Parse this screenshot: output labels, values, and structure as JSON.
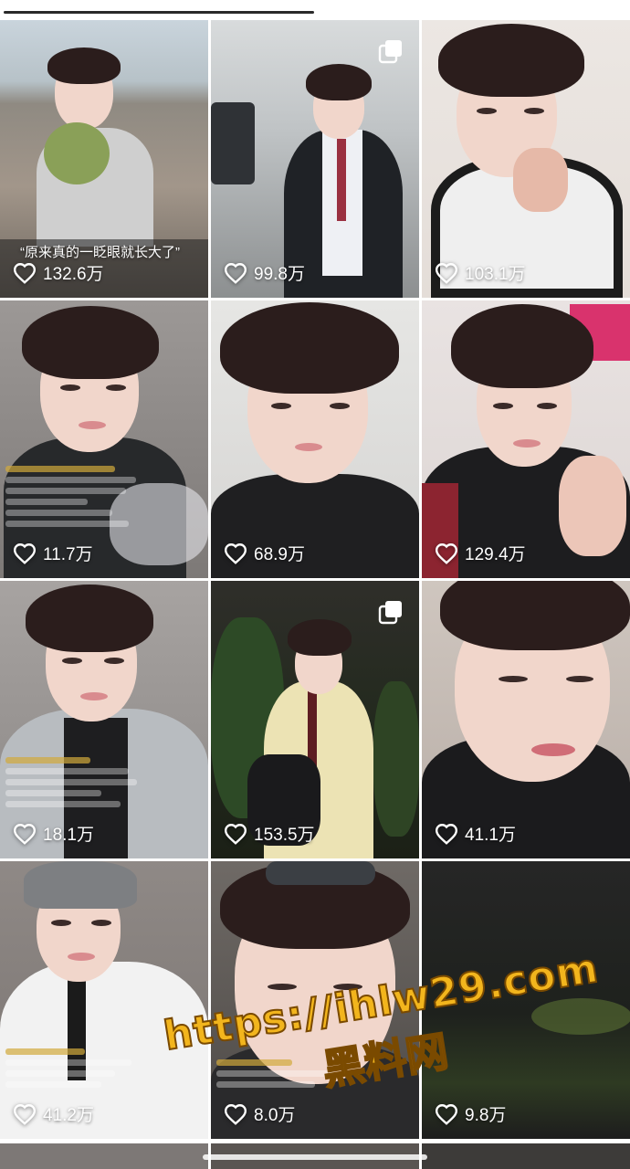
{
  "grid": {
    "tiles": [
      {
        "likes": "132.6万",
        "caption": "“原来真的一眨眼就长大了”",
        "multi": false
      },
      {
        "likes": "99.8万",
        "caption": "",
        "multi": true
      },
      {
        "likes": "103.1万",
        "caption": "",
        "multi": false
      },
      {
        "likes": "11.7万",
        "caption": "",
        "multi": false
      },
      {
        "likes": "68.9万",
        "caption": "",
        "multi": false
      },
      {
        "likes": "129.4万",
        "caption": "",
        "multi": false
      },
      {
        "likes": "18.1万",
        "caption": "",
        "multi": false
      },
      {
        "likes": "153.5万",
        "caption": "",
        "multi": true
      },
      {
        "likes": "41.1万",
        "caption": "",
        "multi": false
      },
      {
        "likes": "41.2万",
        "caption": "",
        "multi": false
      },
      {
        "likes": "8.0万",
        "caption": "",
        "multi": false
      },
      {
        "likes": "9.8万",
        "caption": "",
        "multi": false
      }
    ]
  },
  "watermark": {
    "url": "https://ihlw29.com",
    "name": "黑料网"
  },
  "icons": {
    "like": "heart-outline-icon",
    "multi": "multi-image-icon"
  },
  "colors": {
    "like_text": "#ffffff",
    "watermark": "#f2b51d"
  }
}
